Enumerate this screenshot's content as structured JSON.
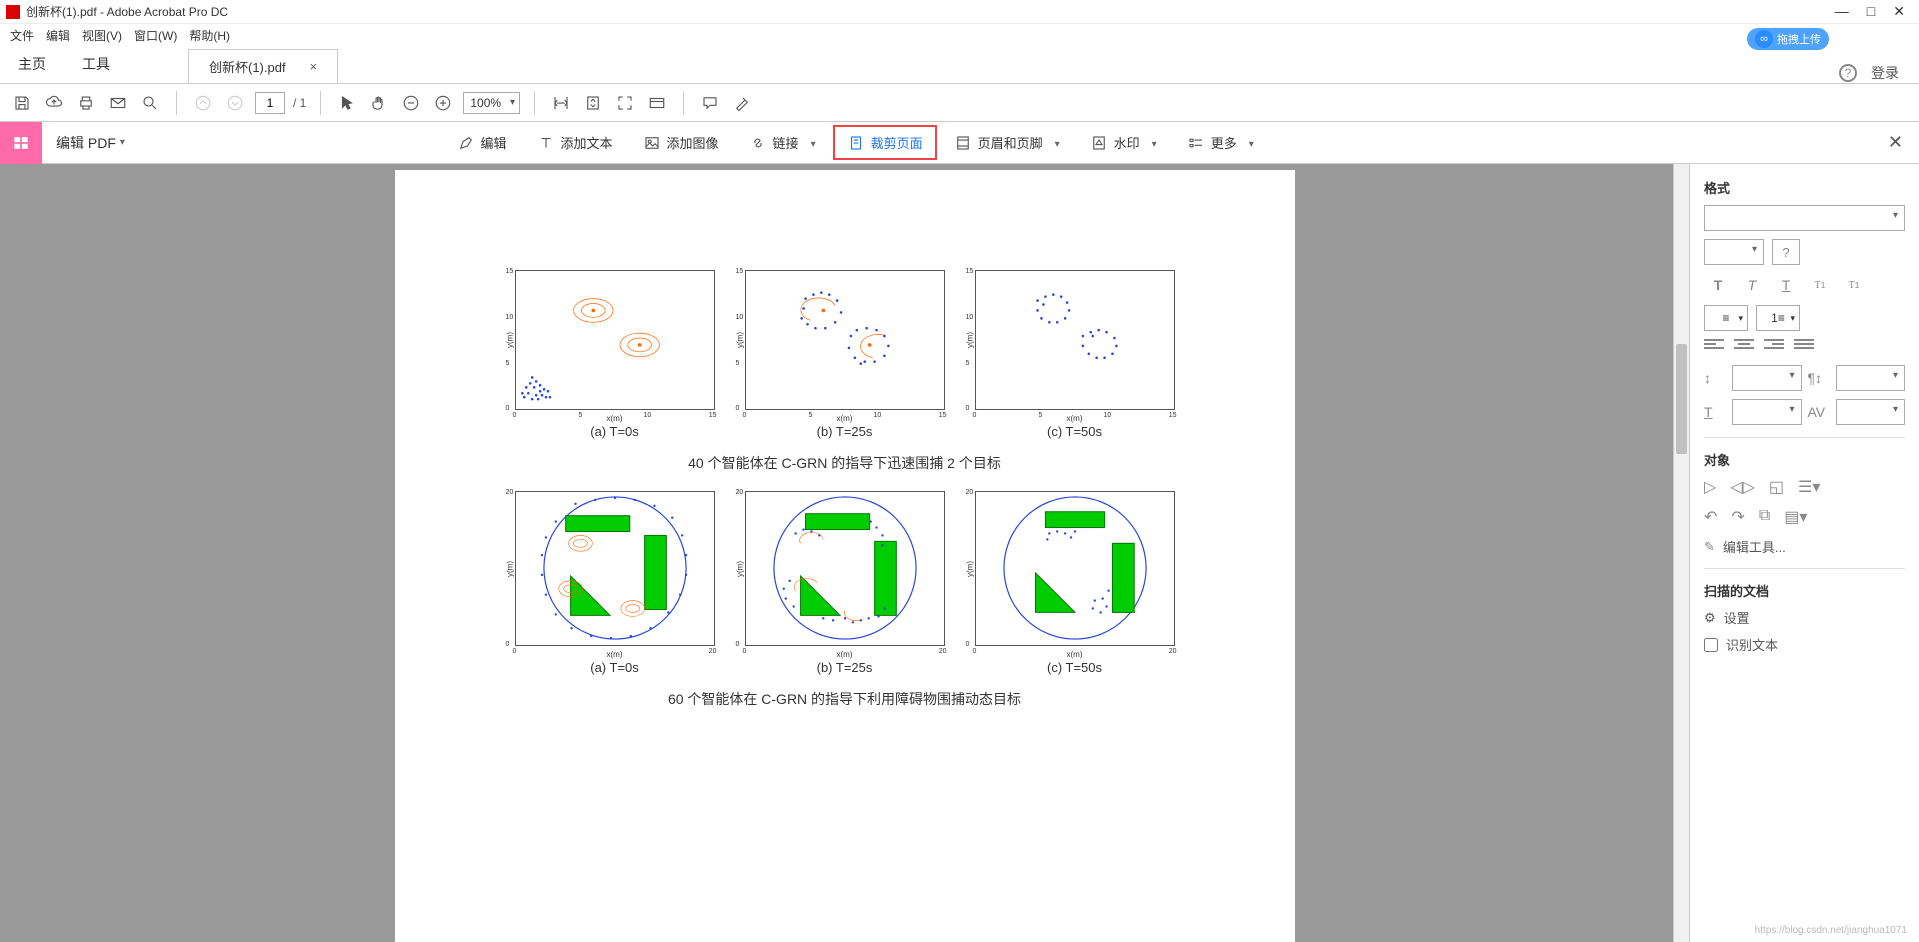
{
  "window": {
    "title": "创新杯(1).pdf - Adobe Acrobat Pro DC",
    "min": "—",
    "max": "□",
    "close": "✕"
  },
  "menu": [
    "文件",
    "编辑",
    "视图(V)",
    "窗口(W)",
    "帮助(H)"
  ],
  "upload_badge": "拖拽上传",
  "tabs": {
    "home": "主页",
    "tools": "工具",
    "doc": "创新杯(1).pdf",
    "login": "登录"
  },
  "toolbar": {
    "page_current": "1",
    "page_total": "/ 1",
    "zoom": "100%"
  },
  "edit_bar": {
    "label": "编辑 PDF",
    "actions": {
      "edit": "编辑",
      "add_text": "添加文本",
      "add_image": "添加图像",
      "link": "链接",
      "crop": "裁剪页面",
      "header_footer": "页眉和页脚",
      "watermark": "水印",
      "more": "更多"
    }
  },
  "doc": {
    "row1_captions": {
      "a": "(a)  T=0s",
      "b": "(b)  T=25s",
      "c": "(c)  T=50s"
    },
    "fig1_title": "40 个智能体在 C-GRN 的指导下迅速围捕 2 个目标",
    "row2_captions": {
      "a": "(a)  T=0s",
      "b": "(b)  T=25s",
      "c": "(c)  T=50s"
    },
    "fig2_title": "60 个智能体在 C-GRN 的指导下利用障碍物围捕动态目标",
    "axis_x": "x(m)",
    "axis_y": "y(m)"
  },
  "right_panel": {
    "format": "格式",
    "object": "对象",
    "edit_tool": "编辑工具...",
    "scanned": "扫描的文档",
    "settings": "设置",
    "recognize": "识别文本",
    "line_spacing_icon": "↕",
    "char_spacing_icon": "AV"
  },
  "watermark_text": "https://blog.csdn.net/jianghua1071"
}
